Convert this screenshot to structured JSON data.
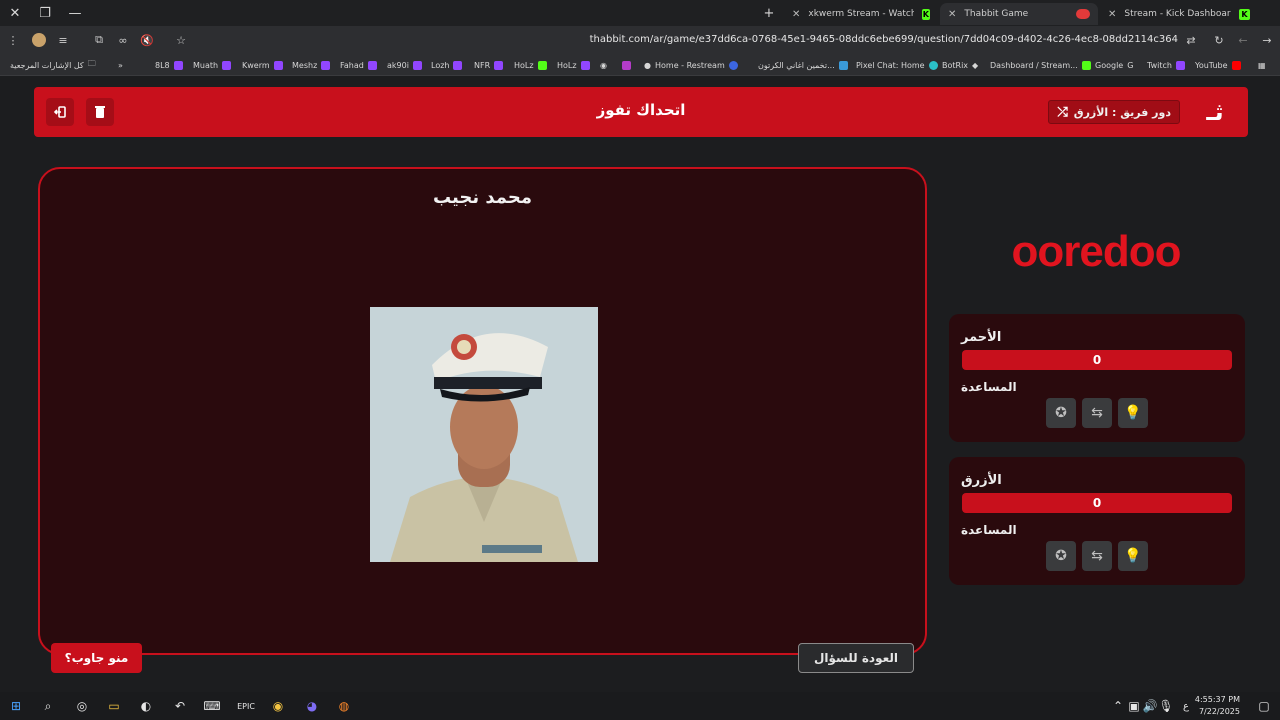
{
  "browser": {
    "tabs": [
      {
        "label": "xkwerm Stream - Watch Live or",
        "active": false
      },
      {
        "label": "Thabbit Game",
        "active": true
      },
      {
        "label": "Stream - Kick Dashboard",
        "active": false
      }
    ],
    "new_tab": "+",
    "url": "thabbit.com/ar/game/e37dd6ca-0768-45e1-9465-08ddc6ebe699/question/7dd04c09-d402-4c26-4ec8-08dd2114c364",
    "bookmarks": [
      "كل الإشارات المرجعية",
      "8L8",
      "Muath",
      "Kwerm",
      "Meshz",
      "Fahad",
      "ak90i",
      "Lozh",
      "NFR",
      "HoLz",
      "HoLz",
      "Home - Restream",
      "تخمين اغاني الكرتون...",
      "Pixel Chat: Home",
      "BotRix",
      "Dashboard / Stream...",
      "Google",
      "Twitch",
      "YouTube"
    ]
  },
  "header": {
    "logo_text": "ثـ",
    "turn_label": "دور فريق : الأزرق",
    "title": "اتحداك تفوز"
  },
  "question": {
    "person_name": "محمد نجيب",
    "who_answered": "منو جاوب؟",
    "back_label": "العودة للسؤال"
  },
  "sponsor": "ooredoo",
  "teams": [
    {
      "name": "الأحمر",
      "score": "0",
      "help_label": "المساعدة"
    },
    {
      "name": "الأزرق",
      "score": "0",
      "help_label": "المساعدة"
    }
  ],
  "taskbar": {
    "time": "4:55:37 PM",
    "date": "7/22/2025",
    "lang": "ع"
  },
  "colors": {
    "brand_red": "#c8101c",
    "card_bg": "#2a0a0d",
    "page_bg": "#1c1d1f"
  }
}
